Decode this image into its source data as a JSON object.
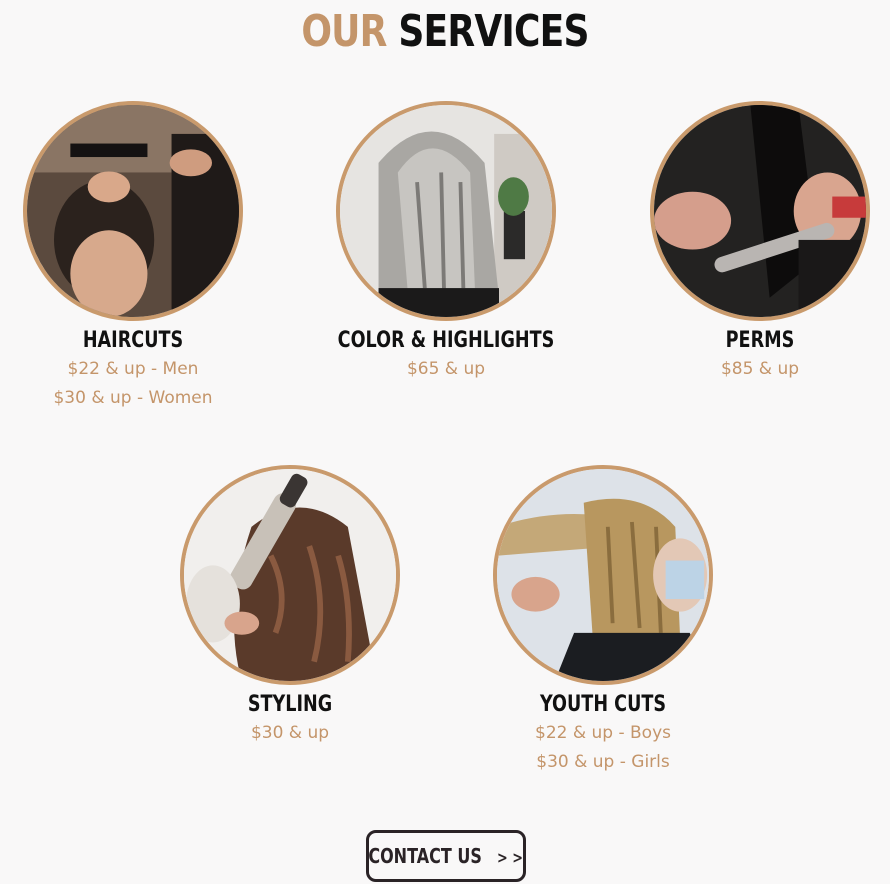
{
  "header": {
    "title_accent": "OUR",
    "title_main": "SERVICES"
  },
  "colors": {
    "accent": "#c4956a",
    "ring": "#c99a6c",
    "text": "#111111",
    "background": "#f9f8f8"
  },
  "services": [
    {
      "name": "HAIRCUTS",
      "prices": [
        "$22 & up - Men",
        "$30 & up - Women"
      ]
    },
    {
      "name": "COLOR & HIGHLIGHTS",
      "prices": [
        "$65 & up"
      ]
    },
    {
      "name": "PERMS",
      "prices": [
        "$85 & up"
      ]
    },
    {
      "name": "STYLING",
      "prices": [
        "$30 & up"
      ]
    },
    {
      "name": "YOUTH CUTS",
      "prices": [
        "$22 & up - Boys",
        "$30 & up - Girls"
      ]
    }
  ],
  "contact": {
    "label": "CONTACT US",
    "arrows": "> >"
  }
}
